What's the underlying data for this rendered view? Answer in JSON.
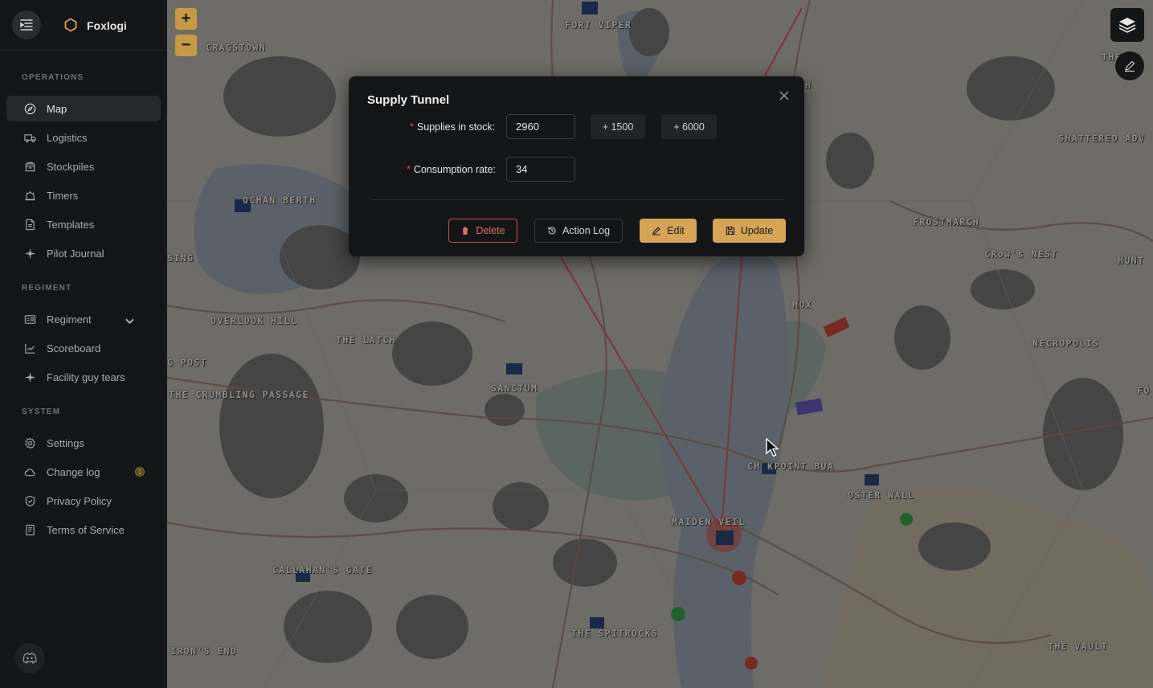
{
  "brand": {
    "name": "Foxlogi"
  },
  "sidebar": {
    "sections": [
      {
        "label": "OPERATIONS"
      },
      {
        "label": "REGIMENT"
      },
      {
        "label": "SYSTEM"
      }
    ],
    "items": [
      {
        "label": "Map",
        "icon": "compass-icon",
        "active": true
      },
      {
        "label": "Logistics",
        "icon": "truck-icon"
      },
      {
        "label": "Stockpiles",
        "icon": "box-icon"
      },
      {
        "label": "Timers",
        "icon": "alarm-icon"
      },
      {
        "label": "Templates",
        "icon": "file-icon"
      },
      {
        "label": "Pilot Journal",
        "icon": "plane-icon"
      },
      {
        "label": "Regiment",
        "icon": "id-card-icon"
      },
      {
        "label": "Scoreboard",
        "icon": "chart-line-icon"
      },
      {
        "label": "Facility guy tears",
        "icon": "plane-icon"
      },
      {
        "label": "Settings",
        "icon": "gear-icon"
      },
      {
        "label": "Change log",
        "icon": "cloud-icon",
        "badge": "1"
      },
      {
        "label": "Privacy Policy",
        "icon": "shield-icon"
      },
      {
        "label": "Terms of Service",
        "icon": "document-icon"
      }
    ]
  },
  "map": {
    "zoom_in": "+",
    "zoom_out": "−",
    "towns": [
      "FORT VIPER",
      "CRAGSTOWN",
      "OCHAN BERTH",
      "SING",
      "OVERLOOK HILL",
      "THE LATCH",
      "G POST",
      "THE CRUMBLING PASSAGE",
      "SANCTUM",
      "MOX",
      "FROSTMARCH",
      "CRow's NEST",
      "HUNT",
      "SHATTERED ADV",
      "NECROPOLIS",
      "FO",
      "CH KPOINT BUA",
      "OSTER WALL",
      "MAIDEN VEIL",
      "CALLAHAN'S GATE",
      "THE SPITROCKS",
      "IRON'S END",
      "THE VAULT",
      "THE FA",
      "H"
    ]
  },
  "modal": {
    "title": "Supply Tunnel",
    "supplies_label": "Supplies in stock",
    "supplies_value": "2960",
    "quick_add_1": "+ 1500",
    "quick_add_2": "+ 6000",
    "consumption_label": "Consumption rate",
    "consumption_value": "34",
    "delete_label": "Delete",
    "log_label": "Action Log",
    "edit_label": "Edit",
    "update_label": "Update"
  },
  "colors": {
    "accent": "#d6a455",
    "danger": "#c0504a",
    "sidebar_bg": "#141517"
  }
}
